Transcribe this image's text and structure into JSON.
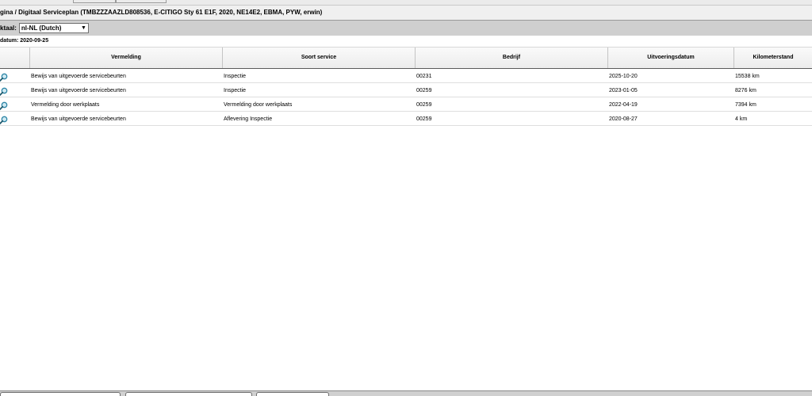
{
  "breadcrumb": {
    "text": "gina / Digitaal Serviceplan (TMBZZZAAZLD808536, E-CITIGO Sty 61 E1F, 2020, NE14E2, EBMA, PYW, erwin)"
  },
  "language": {
    "label": "ktaal:",
    "selected": "nl-NL (Dutch)"
  },
  "delivery_date": {
    "text": "datum: 2020-09-25"
  },
  "table": {
    "headers": [
      "Vermelding",
      "Soort service",
      "Bedrijf",
      "Uitvoeringsdatum",
      "Kilometerstand"
    ],
    "rows": [
      {
        "entry": "Bewijs van uitgevoerde servicebeurten",
        "service": "Inspectie",
        "company": "00231",
        "date": "2025-10-20",
        "km": "15538 km"
      },
      {
        "entry": "Bewijs van uitgevoerde servicebeurten",
        "service": "Inspectie",
        "company": "00259",
        "date": "2023-01-05",
        "km": "8276 km"
      },
      {
        "entry": "Vermelding door werkplaats",
        "service": "Vermelding door werkplaats",
        "company": "00259",
        "date": "2022-04-19",
        "km": "7394 km"
      },
      {
        "entry": "Bewijs van uitgevoerde servicebeurten",
        "service": "Aflevering Inspectie",
        "company": "00259",
        "date": "2020-08-27",
        "km": "4 km"
      }
    ]
  },
  "icons": {
    "row_action": "magnifier-icon",
    "select_arrow": "chevron-down-icon"
  },
  "colors": {
    "icon_handle": "#1f5a6e",
    "icon_lens": "#2e86a6"
  }
}
